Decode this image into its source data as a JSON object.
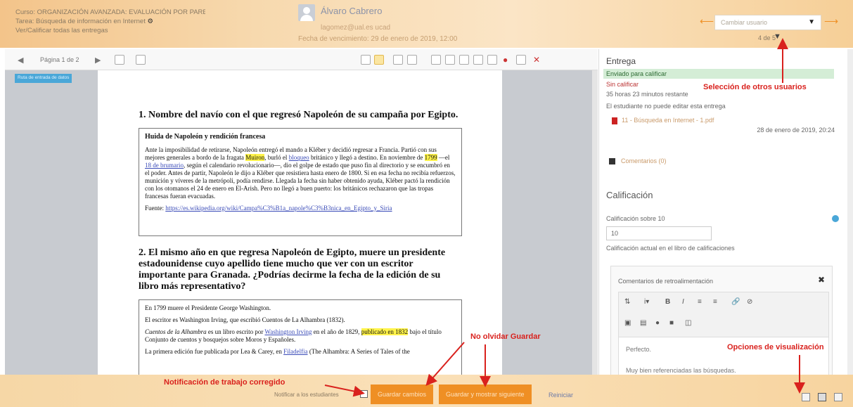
{
  "header": {
    "breadcrumb_line1": "Curso: ORGANIZACIÓN AVANZADA: EVALUACIÓN POR PARES, RÚBRICAS ESCALAS ...",
    "breadcrumb_line2": "Tarea: Búsqueda de información en Internet",
    "breadcrumb_line3": "Ver/Calificar todas las entregas",
    "user_name": "Álvaro Cabrero",
    "user_email": "lagomez@ual.es ucad",
    "due_date": "Fecha de vencimiento: 29 de enero de 2019, 12:00",
    "user_select_placeholder": "Cambiar usuario",
    "counter": "4 de 5"
  },
  "viewer": {
    "page_label": "Página 1 de 2",
    "tag": "Ruta de entrada de datos"
  },
  "document": {
    "q1": "1. Nombre del navío con el que regresó Napoleón de su campaña por Egipto.",
    "box1_heading": "Huida de Napoleón y rendición francesa",
    "box1_text": "Ante la imposibilidad de retirarse, Napoleón entregó el mando a Kléber y decidió regresar a Francia. Partió con sus mejores generales a bordo de la fragata ",
    "box1_hl1": "Muiron",
    "box1_text2": ", burló el ",
    "box1_link1": "bloqueo",
    "box1_text3": " británico y llegó a destino. En noviembre de ",
    "box1_hl2": "1799",
    "box1_text4": " —el ",
    "box1_link2": "18 de brumario",
    "box1_text5": ", según el calendario revolucionario—, dio el golpe de estado que puso fin al directorio y se encumbró en el poder. Antes de partir, Napoleón le dijo a Kléber que resistiera hasta enero de 1800. Si en esa fecha no recibía refuerzos, munición y víveres de la metrópoli, podía rendirse. Llegada la fecha sin haber obtenido ayuda, Kléber pactó la rendición con los otomanos el 24 de enero en El-Arish. Pero no llegó a buen puerto: los británicos rechazaron que las tropas francesas fueran evacuadas.",
    "box1_source_label": "Fuente: ",
    "box1_source_link": "https://es.wikipedia.org/wiki/Campa%C3%B1a_napole%C3%B3nica_en_Egipto_y_Siria",
    "q2": "2. El mismo año en que regresa Napoleón de Egipto, muere un presidente estadounidense cuyo apellido tiene mucho que ver con un escritor importante para Granada. ¿Podrías decirme la fecha de la edición de su libro más representativo?",
    "box2_p1": "En 1799 muere el Presidente George Washington.",
    "box2_p2": "El escritor es Washington Irving, que escribió Cuentos de La Alhambra (1832).",
    "box2_p3a": "Cuentos de la Alhambra",
    "box2_p3b": " es un libro escrito por ",
    "box2_p3link": "Washington Irving",
    "box2_p3c": " en el año de 1829, ",
    "box2_p3hl": "publicado en 1832",
    "box2_p3d": " bajo el título Conjunto de cuentos y bosquejos sobre Moros y Españoles.",
    "box2_p4a": "La primera edición fue publicada por Lea & Carey, en ",
    "box2_p4link": "Filadelfia",
    "box2_p4b": " (The Alhambra: A Series of Tales of the"
  },
  "panel": {
    "title": "Entrega",
    "status": "Enviado para calificar",
    "grade_state": "Sin calificar",
    "time_left": "35 horas 23 minutos restante",
    "edit_note": "El estudiante no puede editar esta entrega",
    "file_name": "11 - Búsqueda en Internet - 1.pdf",
    "file_date": "28 de enero de 2019, 20:24",
    "comments": "Comentarios (0)",
    "grade_heading": "Calificación",
    "grade_label": "Calificación sobre 10",
    "grade_value": "10",
    "grade_current": "Calificación actual en el libro de calificaciones",
    "feedback_title": "Comentarios de retroalimentación",
    "feedback_text1": "Perfecto.",
    "feedback_text2": "Muy bien referenciadas las búsquedas."
  },
  "footer": {
    "notify_label": "Notificar a los estudiantes",
    "save_button": "Guardar cambios",
    "save_next_button": "Guardar y mostrar siguiente",
    "reset_link": "Reiniciar"
  },
  "annotations": {
    "select_users": "Selección de otros usuarios",
    "dont_forget_save": "No olvidar Guardar",
    "graded_notification": "Notificación de trabajo corregido",
    "view_options": "Opciones de visualización"
  },
  "colors": {
    "accent_orange": "#ef8f24",
    "annotation_red": "#d9211d",
    "status_green": "#d4edd6",
    "highlight_yellow": "#fff34a"
  }
}
